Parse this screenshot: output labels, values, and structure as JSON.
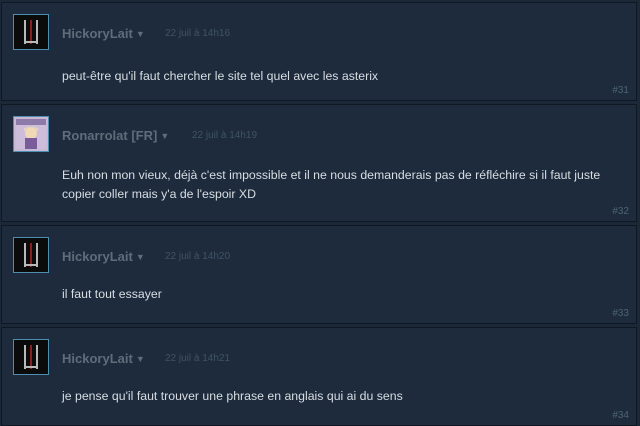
{
  "posts": [
    {
      "author": "HickoryLait",
      "timestamp": "22 juil à 14h16",
      "text": "peut-être qu'il faut chercher le site tel quel avec les asterix",
      "number": "#31",
      "avatar_icon": "hickorylait-avatar-icon"
    },
    {
      "author": "Ronarrolat [FR]",
      "timestamp": "22 juil à 14h19",
      "text": "Euh non mon vieux, déjà c'est impossible et il ne nous demanderais pas de réfléchire si il faut juste copier coller mais y'a de l'espoir XD",
      "number": "#32",
      "avatar_icon": "ronarrolat-avatar-icon"
    },
    {
      "author": "HickoryLait",
      "timestamp": "22 juil à 14h20",
      "text": "il faut tout essayer",
      "number": "#33",
      "avatar_icon": "hickorylait-avatar-icon"
    },
    {
      "author": "HickoryLait",
      "timestamp": "22 juil à 14h21",
      "text": "je pense qu'il faut trouver une phrase en anglais qui ai du sens",
      "number": "#34",
      "avatar_icon": "hickorylait-avatar-icon"
    }
  ],
  "colors": {
    "background": "#1b2838",
    "post_background": "#1e2b3d",
    "author": "#5d6d7a",
    "timestamp": "#3f5366",
    "body_text": "#d7dde2",
    "avatar_border": "#4d8fb0"
  }
}
